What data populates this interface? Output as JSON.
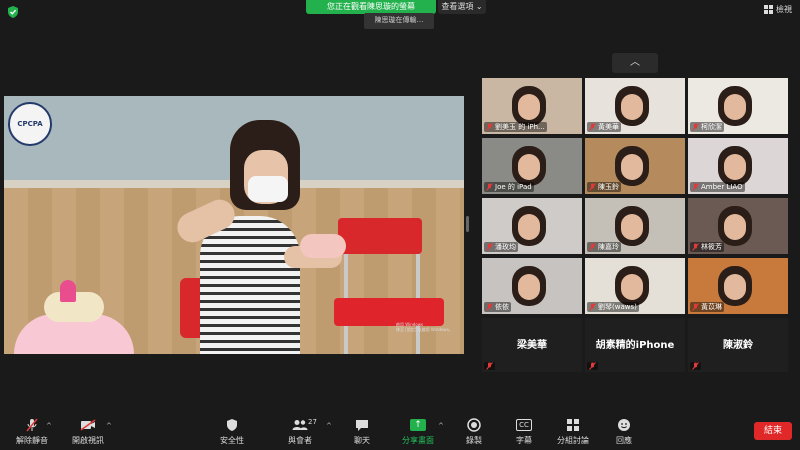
{
  "topbar": {
    "share_banner": "您正在觀看陳思璇的螢幕",
    "view_options": "查看選項",
    "tooltip": "陳思璇在傳輸…",
    "gallery_label": "檢視"
  },
  "main_video": {
    "logo_text": "CPCPA",
    "watermark_line1": "啟用 Windows",
    "watermark_line2": "移至 [設定] 以啟用 Windows。"
  },
  "gallery": {
    "tiles": [
      {
        "name": "劉美玉 的 iPh...",
        "type": "video",
        "bg": "#c9b7a4"
      },
      {
        "name": "黃美華",
        "type": "video",
        "bg": "#e7e2dc"
      },
      {
        "name": "柯欣潔",
        "type": "video",
        "bg": "#ece8e2"
      },
      {
        "name": "Joe 的 iPad",
        "type": "video",
        "bg": "#8a8a86"
      },
      {
        "name": "陳玉鈴",
        "type": "video",
        "bg": "#b58a5c"
      },
      {
        "name": "Amber LIAO",
        "type": "video",
        "bg": "#dcd6d6"
      },
      {
        "name": "潘玫均",
        "type": "video",
        "bg": "#cfcbc8"
      },
      {
        "name": "陳嘉玲",
        "type": "video",
        "bg": "#c4c0b7"
      },
      {
        "name": "林筱芳",
        "type": "video",
        "bg": "#6b5a54"
      },
      {
        "name": "依依",
        "type": "video",
        "bg": "#c6c3c0"
      },
      {
        "name": "劉琴(waws)",
        "type": "video",
        "bg": "#e4e0d8"
      },
      {
        "name": "黃苡琳",
        "type": "video",
        "bg": "#c77a3c"
      },
      {
        "name": "梁美華",
        "type": "name"
      },
      {
        "name": "胡素精的iPhone",
        "type": "name"
      },
      {
        "name": "陳淑鈴",
        "type": "name"
      }
    ]
  },
  "toolbar": {
    "unmute": "解除靜音",
    "start_video": "開啟視訊",
    "security": "安全性",
    "participants": "與會者",
    "participants_count": "27",
    "chat": "聊天",
    "share_screen": "分享畫面",
    "record": "錄製",
    "cc": "字幕",
    "cc_icon": "CC",
    "breakout": "分組討論",
    "reactions": "回應",
    "end": "結束"
  },
  "colors": {
    "share_green": "#23b14d",
    "end_red": "#e02828",
    "background": "#1a1a1a"
  }
}
